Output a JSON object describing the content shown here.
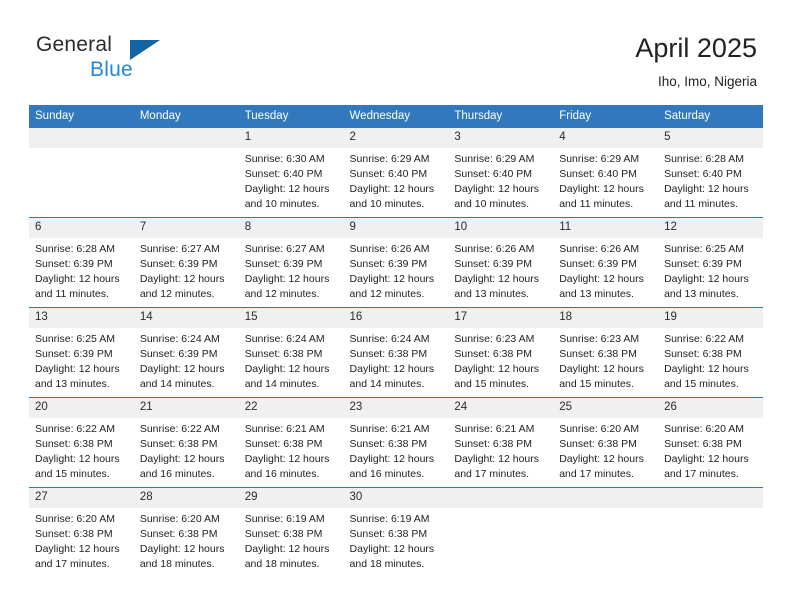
{
  "brand": {
    "name_part1": "General",
    "name_part2": "Blue",
    "triangle_color": "#1464a5",
    "blue_color": "#1f87dc"
  },
  "header": {
    "title": "April 2025",
    "subtitle": "Iho, Imo, Nigeria",
    "header_bg": "#3179bc",
    "daynum_bg": "#f0f0f0"
  },
  "weekdays": [
    "Sunday",
    "Monday",
    "Tuesday",
    "Wednesday",
    "Thursday",
    "Friday",
    "Saturday"
  ],
  "labels": {
    "sunrise": "Sunrise:",
    "sunset": "Sunset:",
    "daylight": "Daylight:"
  },
  "weeks": [
    [
      {
        "day": "",
        "sunrise": "",
        "sunset": "",
        "daylight_line1": "",
        "daylight_line2": ""
      },
      {
        "day": "",
        "sunrise": "",
        "sunset": "",
        "daylight_line1": "",
        "daylight_line2": ""
      },
      {
        "day": "1",
        "sunrise": "Sunrise: 6:30 AM",
        "sunset": "Sunset: 6:40 PM",
        "daylight_line1": "Daylight: 12 hours",
        "daylight_line2": "and 10 minutes."
      },
      {
        "day": "2",
        "sunrise": "Sunrise: 6:29 AM",
        "sunset": "Sunset: 6:40 PM",
        "daylight_line1": "Daylight: 12 hours",
        "daylight_line2": "and 10 minutes."
      },
      {
        "day": "3",
        "sunrise": "Sunrise: 6:29 AM",
        "sunset": "Sunset: 6:40 PM",
        "daylight_line1": "Daylight: 12 hours",
        "daylight_line2": "and 10 minutes."
      },
      {
        "day": "4",
        "sunrise": "Sunrise: 6:29 AM",
        "sunset": "Sunset: 6:40 PM",
        "daylight_line1": "Daylight: 12 hours",
        "daylight_line2": "and 11 minutes."
      },
      {
        "day": "5",
        "sunrise": "Sunrise: 6:28 AM",
        "sunset": "Sunset: 6:40 PM",
        "daylight_line1": "Daylight: 12 hours",
        "daylight_line2": "and 11 minutes."
      }
    ],
    [
      {
        "day": "6",
        "sunrise": "Sunrise: 6:28 AM",
        "sunset": "Sunset: 6:39 PM",
        "daylight_line1": "Daylight: 12 hours",
        "daylight_line2": "and 11 minutes."
      },
      {
        "day": "7",
        "sunrise": "Sunrise: 6:27 AM",
        "sunset": "Sunset: 6:39 PM",
        "daylight_line1": "Daylight: 12 hours",
        "daylight_line2": "and 12 minutes."
      },
      {
        "day": "8",
        "sunrise": "Sunrise: 6:27 AM",
        "sunset": "Sunset: 6:39 PM",
        "daylight_line1": "Daylight: 12 hours",
        "daylight_line2": "and 12 minutes."
      },
      {
        "day": "9",
        "sunrise": "Sunrise: 6:26 AM",
        "sunset": "Sunset: 6:39 PM",
        "daylight_line1": "Daylight: 12 hours",
        "daylight_line2": "and 12 minutes."
      },
      {
        "day": "10",
        "sunrise": "Sunrise: 6:26 AM",
        "sunset": "Sunset: 6:39 PM",
        "daylight_line1": "Daylight: 12 hours",
        "daylight_line2": "and 13 minutes."
      },
      {
        "day": "11",
        "sunrise": "Sunrise: 6:26 AM",
        "sunset": "Sunset: 6:39 PM",
        "daylight_line1": "Daylight: 12 hours",
        "daylight_line2": "and 13 minutes."
      },
      {
        "day": "12",
        "sunrise": "Sunrise: 6:25 AM",
        "sunset": "Sunset: 6:39 PM",
        "daylight_line1": "Daylight: 12 hours",
        "daylight_line2": "and 13 minutes."
      }
    ],
    [
      {
        "day": "13",
        "sunrise": "Sunrise: 6:25 AM",
        "sunset": "Sunset: 6:39 PM",
        "daylight_line1": "Daylight: 12 hours",
        "daylight_line2": "and 13 minutes."
      },
      {
        "day": "14",
        "sunrise": "Sunrise: 6:24 AM",
        "sunset": "Sunset: 6:39 PM",
        "daylight_line1": "Daylight: 12 hours",
        "daylight_line2": "and 14 minutes."
      },
      {
        "day": "15",
        "sunrise": "Sunrise: 6:24 AM",
        "sunset": "Sunset: 6:38 PM",
        "daylight_line1": "Daylight: 12 hours",
        "daylight_line2": "and 14 minutes."
      },
      {
        "day": "16",
        "sunrise": "Sunrise: 6:24 AM",
        "sunset": "Sunset: 6:38 PM",
        "daylight_line1": "Daylight: 12 hours",
        "daylight_line2": "and 14 minutes."
      },
      {
        "day": "17",
        "sunrise": "Sunrise: 6:23 AM",
        "sunset": "Sunset: 6:38 PM",
        "daylight_line1": "Daylight: 12 hours",
        "daylight_line2": "and 15 minutes."
      },
      {
        "day": "18",
        "sunrise": "Sunrise: 6:23 AM",
        "sunset": "Sunset: 6:38 PM",
        "daylight_line1": "Daylight: 12 hours",
        "daylight_line2": "and 15 minutes."
      },
      {
        "day": "19",
        "sunrise": "Sunrise: 6:22 AM",
        "sunset": "Sunset: 6:38 PM",
        "daylight_line1": "Daylight: 12 hours",
        "daylight_line2": "and 15 minutes."
      }
    ],
    [
      {
        "day": "20",
        "sunrise": "Sunrise: 6:22 AM",
        "sunset": "Sunset: 6:38 PM",
        "daylight_line1": "Daylight: 12 hours",
        "daylight_line2": "and 15 minutes."
      },
      {
        "day": "21",
        "sunrise": "Sunrise: 6:22 AM",
        "sunset": "Sunset: 6:38 PM",
        "daylight_line1": "Daylight: 12 hours",
        "daylight_line2": "and 16 minutes."
      },
      {
        "day": "22",
        "sunrise": "Sunrise: 6:21 AM",
        "sunset": "Sunset: 6:38 PM",
        "daylight_line1": "Daylight: 12 hours",
        "daylight_line2": "and 16 minutes."
      },
      {
        "day": "23",
        "sunrise": "Sunrise: 6:21 AM",
        "sunset": "Sunset: 6:38 PM",
        "daylight_line1": "Daylight: 12 hours",
        "daylight_line2": "and 16 minutes."
      },
      {
        "day": "24",
        "sunrise": "Sunrise: 6:21 AM",
        "sunset": "Sunset: 6:38 PM",
        "daylight_line1": "Daylight: 12 hours",
        "daylight_line2": "and 17 minutes."
      },
      {
        "day": "25",
        "sunrise": "Sunrise: 6:20 AM",
        "sunset": "Sunset: 6:38 PM",
        "daylight_line1": "Daylight: 12 hours",
        "daylight_line2": "and 17 minutes."
      },
      {
        "day": "26",
        "sunrise": "Sunrise: 6:20 AM",
        "sunset": "Sunset: 6:38 PM",
        "daylight_line1": "Daylight: 12 hours",
        "daylight_line2": "and 17 minutes."
      }
    ],
    [
      {
        "day": "27",
        "sunrise": "Sunrise: 6:20 AM",
        "sunset": "Sunset: 6:38 PM",
        "daylight_line1": "Daylight: 12 hours",
        "daylight_line2": "and 17 minutes."
      },
      {
        "day": "28",
        "sunrise": "Sunrise: 6:20 AM",
        "sunset": "Sunset: 6:38 PM",
        "daylight_line1": "Daylight: 12 hours",
        "daylight_line2": "and 18 minutes."
      },
      {
        "day": "29",
        "sunrise": "Sunrise: 6:19 AM",
        "sunset": "Sunset: 6:38 PM",
        "daylight_line1": "Daylight: 12 hours",
        "daylight_line2": "and 18 minutes."
      },
      {
        "day": "30",
        "sunrise": "Sunrise: 6:19 AM",
        "sunset": "Sunset: 6:38 PM",
        "daylight_line1": "Daylight: 12 hours",
        "daylight_line2": "and 18 minutes."
      },
      {
        "day": "",
        "sunrise": "",
        "sunset": "",
        "daylight_line1": "",
        "daylight_line2": ""
      },
      {
        "day": "",
        "sunrise": "",
        "sunset": "",
        "daylight_line1": "",
        "daylight_line2": ""
      },
      {
        "day": "",
        "sunrise": "",
        "sunset": "",
        "daylight_line1": "",
        "daylight_line2": ""
      }
    ]
  ]
}
